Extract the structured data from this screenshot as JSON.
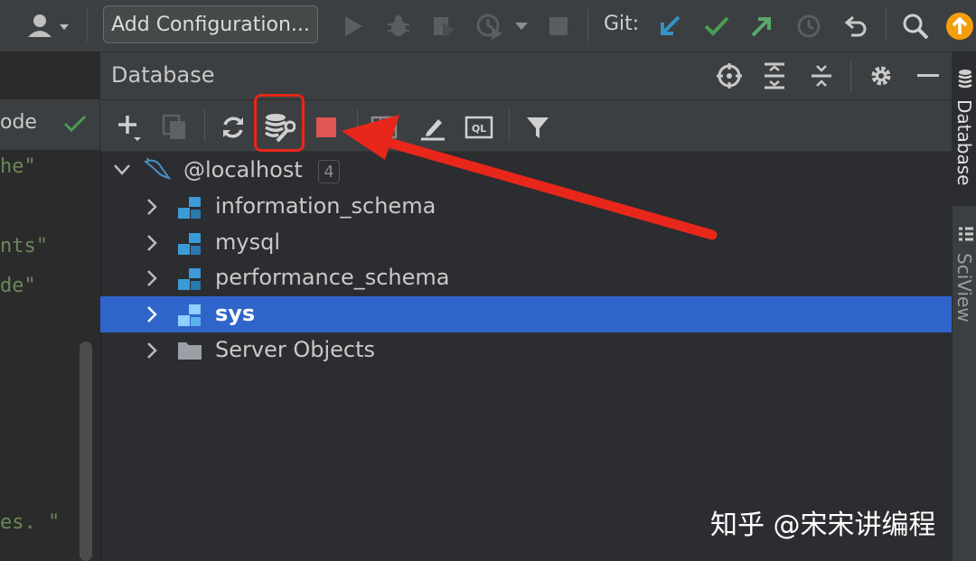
{
  "toolbar": {
    "run_config_label": "Add Configuration...",
    "git_label": "Git:"
  },
  "editor": {
    "tab_fragment": "ode",
    "code_lines": [
      "he\"",
      "nts\"",
      "de\"",
      "es. \""
    ]
  },
  "panel": {
    "title": "Database"
  },
  "tree": {
    "root": {
      "label": "@localhost",
      "count": "4"
    },
    "items": [
      {
        "label": "information_schema",
        "kind": "schema"
      },
      {
        "label": "mysql",
        "kind": "schema"
      },
      {
        "label": "performance_schema",
        "kind": "schema"
      },
      {
        "label": "sys",
        "kind": "schema",
        "selected": true
      },
      {
        "label": "Server Objects",
        "kind": "folder"
      }
    ]
  },
  "right_tabs": {
    "database": "Database",
    "sciview": "SciView"
  },
  "watermark": "知乎 @宋宋讲编程",
  "colors": {
    "selection": "#2f65ca",
    "annotation": "#e8261a",
    "stop": "#e05555",
    "git_update": "#3592c4",
    "git_commit": "#499c54",
    "git_push": "#59a869",
    "update_badge": "#f49e0b"
  }
}
